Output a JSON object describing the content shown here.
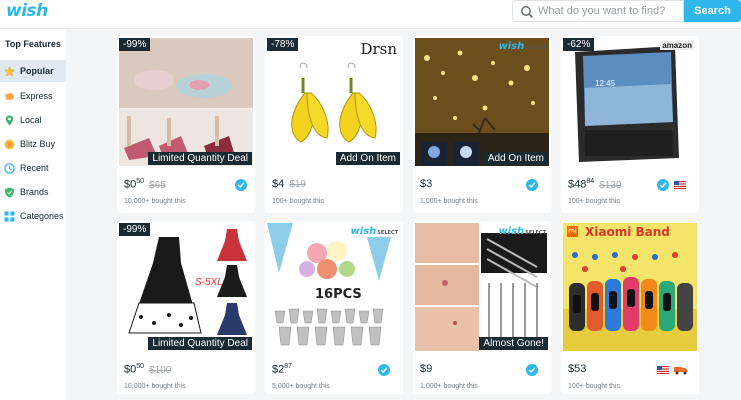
{
  "header": {
    "logo": "wish",
    "search_placeholder": "What do you want to find?",
    "search_button": "Search"
  },
  "sidebar": {
    "title": "Top Features",
    "items": [
      {
        "label": "Popular",
        "icon": "star-icon",
        "active": true
      },
      {
        "label": "Express",
        "icon": "express-icon"
      },
      {
        "label": "Local",
        "icon": "location-pin-icon"
      },
      {
        "label": "Blitz Buy",
        "icon": "blitz-buy-icon"
      },
      {
        "label": "Recent",
        "icon": "clock-icon"
      },
      {
        "label": "Brands",
        "icon": "shield-icon"
      },
      {
        "label": "Categories",
        "icon": "grid-icon"
      }
    ]
  },
  "products": [
    {
      "discount": "-99%",
      "tag": "Limited Quantity Deal",
      "price": "$0",
      "price_cents": "50",
      "original": "$65",
      "bought": "10,000+ bought this",
      "verified": true
    },
    {
      "discount": "-78%",
      "brand_text": "Drsn",
      "tag": "Add On Item",
      "price": "$4",
      "original": "$19",
      "bought": "100+ bought this"
    },
    {
      "brand_badge": "wish",
      "brand_badge_sub": "SELECT",
      "tag": "Add On Item",
      "price": "$3",
      "bought": "1,000+ bought this",
      "verified": true
    },
    {
      "discount": "-62%",
      "brand_badge": "amazon",
      "price": "$48",
      "price_cents": "84",
      "original": "$130",
      "bought": "100+ bought this",
      "verified": true,
      "flag": "us-flag-icon"
    },
    {
      "discount": "-99%",
      "image_text": "S-5XL",
      "tag": "Limited Quantity Deal",
      "price": "$0",
      "price_cents": "50",
      "original": "$100",
      "bought": "10,000+ bought this"
    },
    {
      "brand_badge": "wish",
      "brand_badge_sub": "SELECT",
      "image_text": "16PCS",
      "price": "$2",
      "price_cents": "87",
      "bought": "5,000+ bought this",
      "verified": true
    },
    {
      "brand_badge": "wish",
      "brand_badge_sub": "SELECT",
      "tag": "Almost Gone!",
      "price": "$9",
      "bought": "1,000+ bought this",
      "verified": true
    },
    {
      "image_text": "Xiaomi Band",
      "image_text_badge": "mi",
      "price": "$53",
      "bought": "100+ bought this",
      "flag": "us-flag-icon",
      "truck": "truck-icon"
    }
  ]
}
